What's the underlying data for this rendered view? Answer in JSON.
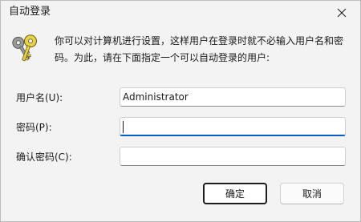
{
  "window": {
    "title": "自动登录",
    "close_icon": "close-icon"
  },
  "description": "你可以对计算机进行设置，这样用户在登录时就不必输入用户名和密码。为此，请在下面指定一个可以自动登录的用户:",
  "key_icon": "keys-icon",
  "fields": {
    "username": {
      "label": "用户名(U):",
      "value": "Administrator"
    },
    "password": {
      "label": "密码(P):",
      "value": ""
    },
    "confirm": {
      "label": "确认密码(C):",
      "value": ""
    }
  },
  "buttons": {
    "ok": "确定",
    "cancel": "取消"
  },
  "colors": {
    "focus_accent": "#005fb8",
    "window_bg": "#f3f3f3"
  }
}
